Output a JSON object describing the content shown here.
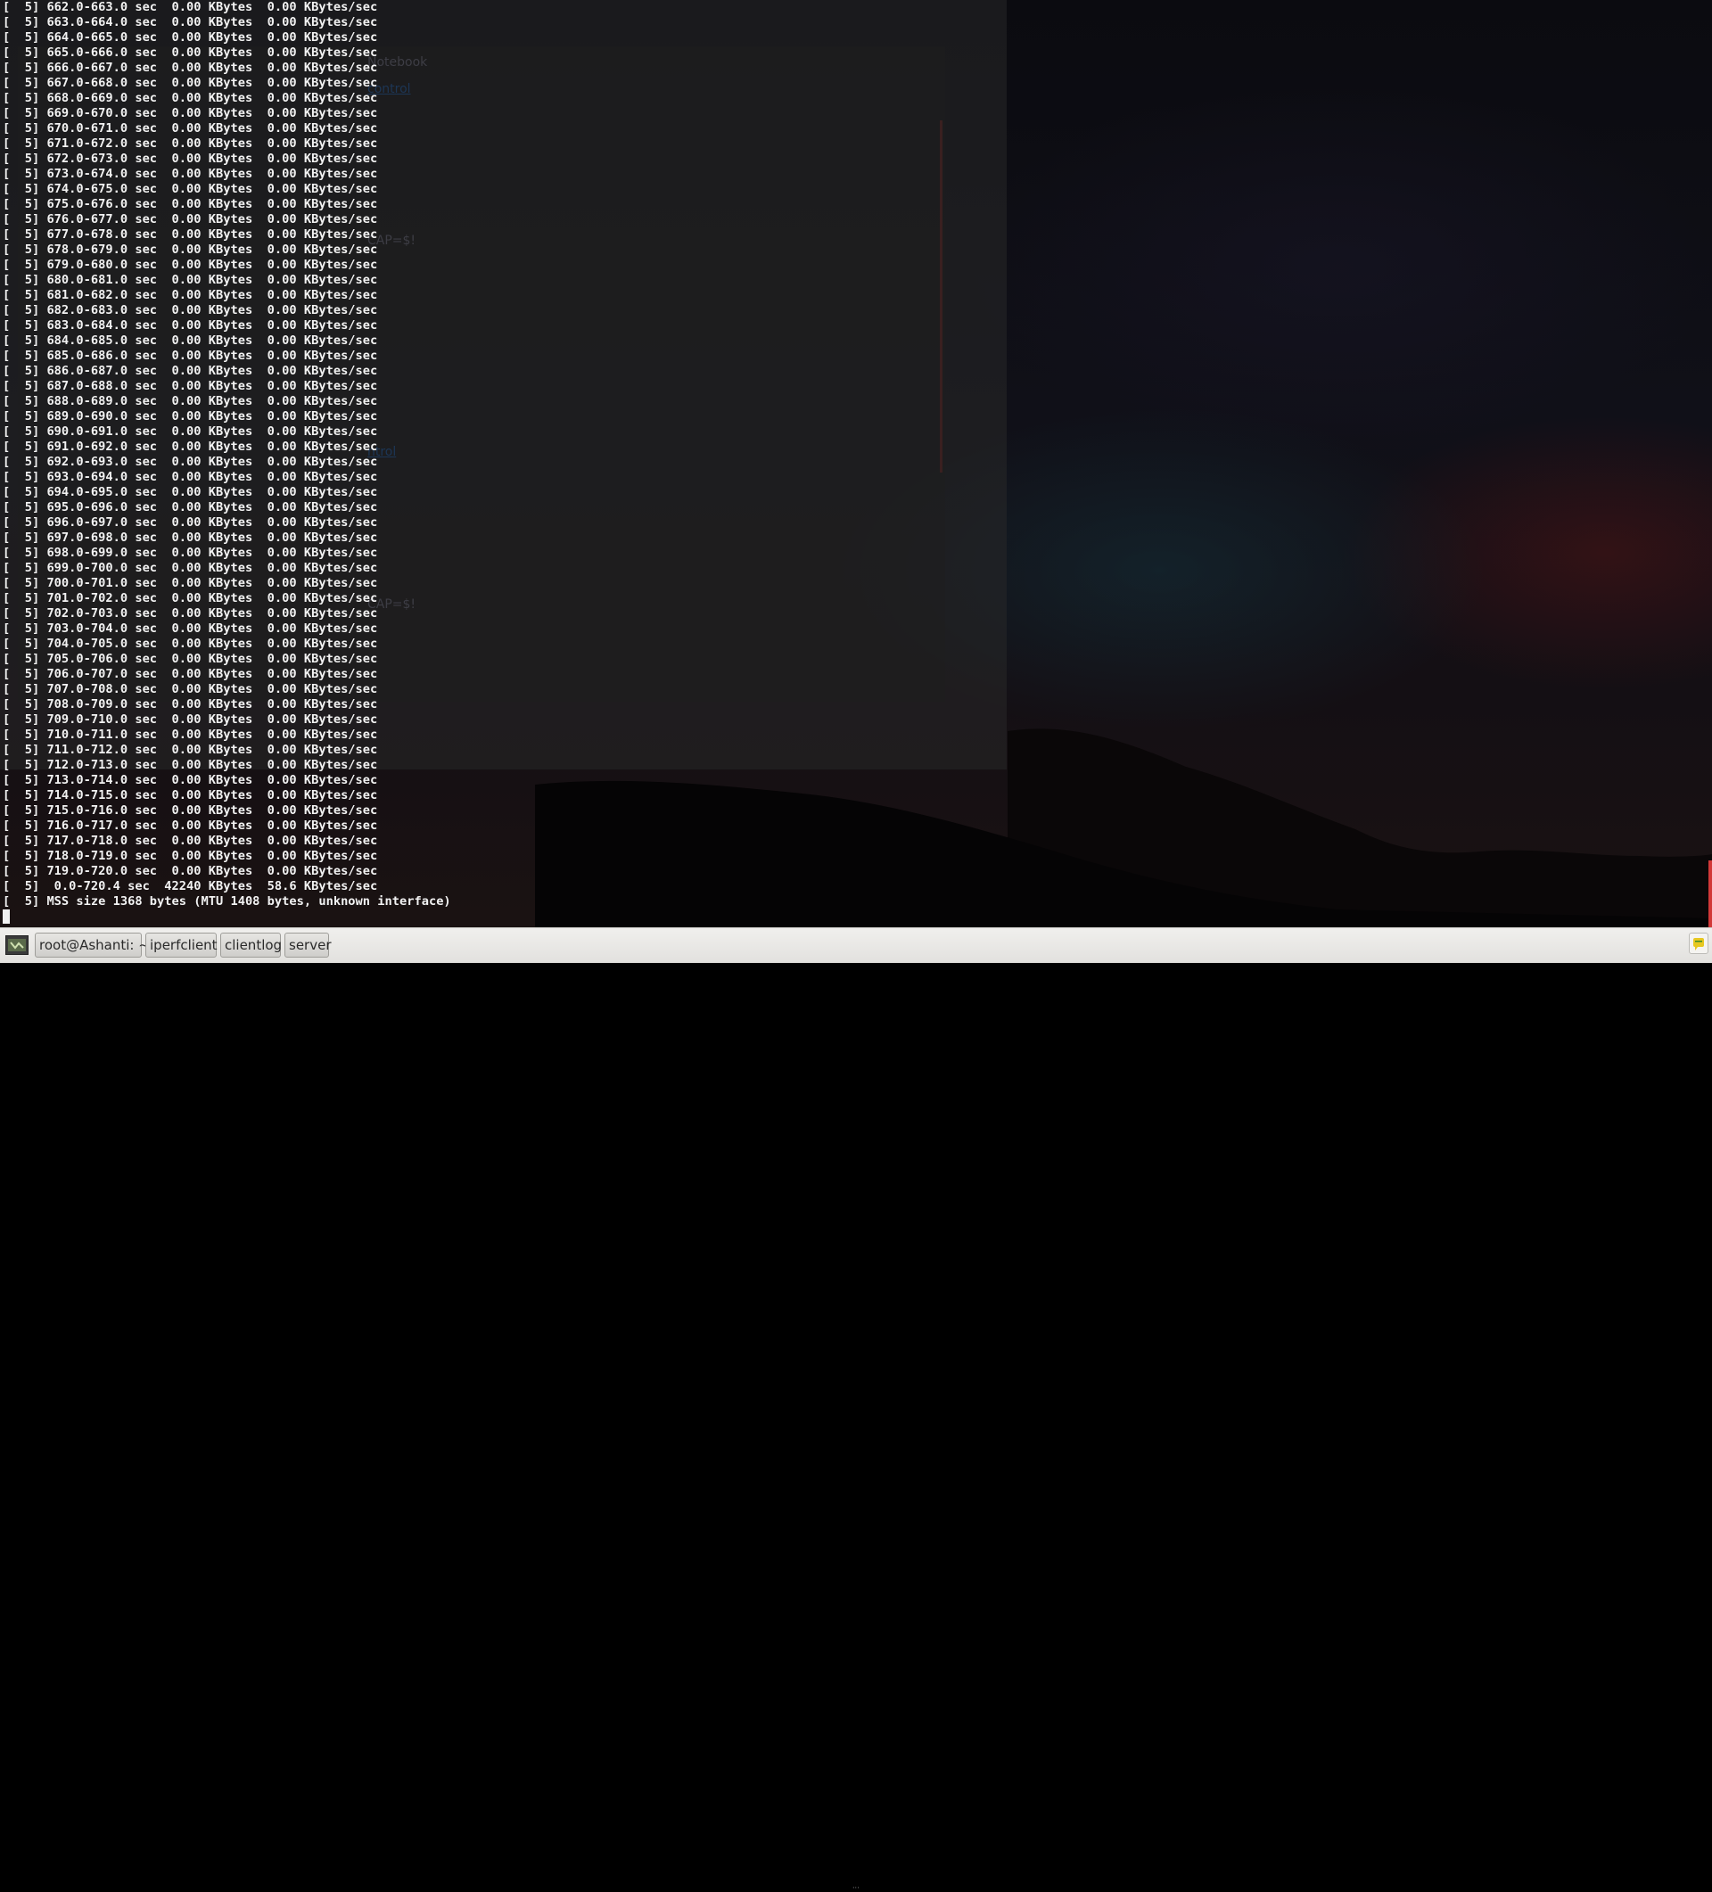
{
  "background_window": {
    "title": "Notebook",
    "link_1": "control",
    "text_1": "CAP=$!",
    "link_2": "ntrol",
    "text_2": "CAP=$!"
  },
  "terminal": {
    "lines": [
      "[  5] 662.0-663.0 sec  0.00 KBytes  0.00 KBytes/sec",
      "[  5] 663.0-664.0 sec  0.00 KBytes  0.00 KBytes/sec",
      "[  5] 664.0-665.0 sec  0.00 KBytes  0.00 KBytes/sec",
      "[  5] 665.0-666.0 sec  0.00 KBytes  0.00 KBytes/sec",
      "[  5] 666.0-667.0 sec  0.00 KBytes  0.00 KBytes/sec",
      "[  5] 667.0-668.0 sec  0.00 KBytes  0.00 KBytes/sec",
      "[  5] 668.0-669.0 sec  0.00 KBytes  0.00 KBytes/sec",
      "[  5] 669.0-670.0 sec  0.00 KBytes  0.00 KBytes/sec",
      "[  5] 670.0-671.0 sec  0.00 KBytes  0.00 KBytes/sec",
      "[  5] 671.0-672.0 sec  0.00 KBytes  0.00 KBytes/sec",
      "[  5] 672.0-673.0 sec  0.00 KBytes  0.00 KBytes/sec",
      "[  5] 673.0-674.0 sec  0.00 KBytes  0.00 KBytes/sec",
      "[  5] 674.0-675.0 sec  0.00 KBytes  0.00 KBytes/sec",
      "[  5] 675.0-676.0 sec  0.00 KBytes  0.00 KBytes/sec",
      "[  5] 676.0-677.0 sec  0.00 KBytes  0.00 KBytes/sec",
      "[  5] 677.0-678.0 sec  0.00 KBytes  0.00 KBytes/sec",
      "[  5] 678.0-679.0 sec  0.00 KBytes  0.00 KBytes/sec",
      "[  5] 679.0-680.0 sec  0.00 KBytes  0.00 KBytes/sec",
      "[  5] 680.0-681.0 sec  0.00 KBytes  0.00 KBytes/sec",
      "[  5] 681.0-682.0 sec  0.00 KBytes  0.00 KBytes/sec",
      "[  5] 682.0-683.0 sec  0.00 KBytes  0.00 KBytes/sec",
      "[  5] 683.0-684.0 sec  0.00 KBytes  0.00 KBytes/sec",
      "[  5] 684.0-685.0 sec  0.00 KBytes  0.00 KBytes/sec",
      "[  5] 685.0-686.0 sec  0.00 KBytes  0.00 KBytes/sec",
      "[  5] 686.0-687.0 sec  0.00 KBytes  0.00 KBytes/sec",
      "[  5] 687.0-688.0 sec  0.00 KBytes  0.00 KBytes/sec",
      "[  5] 688.0-689.0 sec  0.00 KBytes  0.00 KBytes/sec",
      "[  5] 689.0-690.0 sec  0.00 KBytes  0.00 KBytes/sec",
      "[  5] 690.0-691.0 sec  0.00 KBytes  0.00 KBytes/sec",
      "[  5] 691.0-692.0 sec  0.00 KBytes  0.00 KBytes/sec",
      "[  5] 692.0-693.0 sec  0.00 KBytes  0.00 KBytes/sec",
      "[  5] 693.0-694.0 sec  0.00 KBytes  0.00 KBytes/sec",
      "[  5] 694.0-695.0 sec  0.00 KBytes  0.00 KBytes/sec",
      "[  5] 695.0-696.0 sec  0.00 KBytes  0.00 KBytes/sec",
      "[  5] 696.0-697.0 sec  0.00 KBytes  0.00 KBytes/sec",
      "[  5] 697.0-698.0 sec  0.00 KBytes  0.00 KBytes/sec",
      "[  5] 698.0-699.0 sec  0.00 KBytes  0.00 KBytes/sec",
      "[  5] 699.0-700.0 sec  0.00 KBytes  0.00 KBytes/sec",
      "[  5] 700.0-701.0 sec  0.00 KBytes  0.00 KBytes/sec",
      "[  5] 701.0-702.0 sec  0.00 KBytes  0.00 KBytes/sec",
      "[  5] 702.0-703.0 sec  0.00 KBytes  0.00 KBytes/sec",
      "[  5] 703.0-704.0 sec  0.00 KBytes  0.00 KBytes/sec",
      "[  5] 704.0-705.0 sec  0.00 KBytes  0.00 KBytes/sec",
      "[  5] 705.0-706.0 sec  0.00 KBytes  0.00 KBytes/sec",
      "[  5] 706.0-707.0 sec  0.00 KBytes  0.00 KBytes/sec",
      "[  5] 707.0-708.0 sec  0.00 KBytes  0.00 KBytes/sec",
      "[  5] 708.0-709.0 sec  0.00 KBytes  0.00 KBytes/sec",
      "[  5] 709.0-710.0 sec  0.00 KBytes  0.00 KBytes/sec",
      "[  5] 710.0-711.0 sec  0.00 KBytes  0.00 KBytes/sec",
      "[  5] 711.0-712.0 sec  0.00 KBytes  0.00 KBytes/sec",
      "[  5] 712.0-713.0 sec  0.00 KBytes  0.00 KBytes/sec",
      "[  5] 713.0-714.0 sec  0.00 KBytes  0.00 KBytes/sec",
      "[  5] 714.0-715.0 sec  0.00 KBytes  0.00 KBytes/sec",
      "[  5] 715.0-716.0 sec  0.00 KBytes  0.00 KBytes/sec",
      "[  5] 716.0-717.0 sec  0.00 KBytes  0.00 KBytes/sec",
      "[  5] 717.0-718.0 sec  0.00 KBytes  0.00 KBytes/sec",
      "[  5] 718.0-719.0 sec  0.00 KBytes  0.00 KBytes/sec",
      "[  5] 719.0-720.0 sec  0.00 KBytes  0.00 KBytes/sec",
      "[  5]  0.0-720.4 sec  42240 KBytes  58.6 KBytes/sec",
      "[  5] MSS size 1368 bytes (MTU 1408 bytes, unknown interface)"
    ]
  },
  "taskbar": {
    "show_desktop_icon": "show-desktop-icon",
    "tasks": [
      "root@Ashanti: ~",
      "iperfclient",
      "clientlog",
      "server"
    ],
    "notification_icon": "notification-icon",
    "accent_color": "#e7c820"
  }
}
